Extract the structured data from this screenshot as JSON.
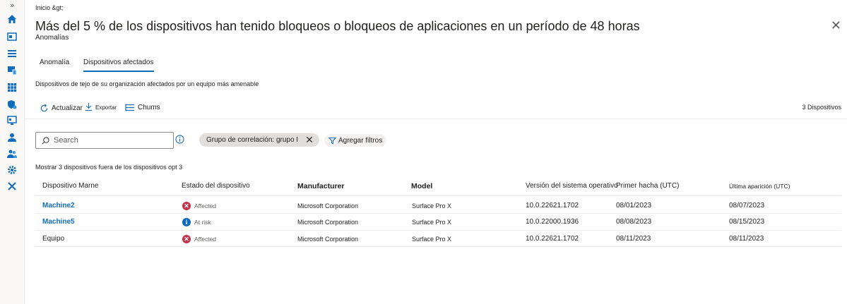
{
  "rail": {
    "expand_glyph": "»",
    "icons": [
      "home-icon",
      "dashboard-icon",
      "list-icon",
      "devices-icon",
      "apps-icon",
      "security-icon",
      "monitor-icon",
      "user-icon",
      "group-icon",
      "settings-gear-icon",
      "tools-icon"
    ]
  },
  "breadcrumb": "Inicio &gt;",
  "title": "Más del 5 % de los dispositivos han tenido bloqueos o bloqueos de aplicaciones en un período de 48 horas",
  "subtitle": "Anomalías",
  "close_glyph": "✕",
  "tabs": [
    {
      "label": "Anomalía"
    },
    {
      "label": "Dispositivos afectados"
    }
  ],
  "description": "Dispositivos de tejo de su organización afectados por un equipo más amenable",
  "commands": {
    "refresh": "Actualizar",
    "export": "Exportar",
    "columns": "Chums"
  },
  "device_count": "3  Dispositivos",
  "search": {
    "placeholder": "Search"
  },
  "filter_pill": {
    "label": "Grupo de correlación: grupo I",
    "remove_glyph": "✕"
  },
  "add_filters": "Agregar filtros",
  "showing_text": "Mostrar 3 dispositivos fuera de los dispositivos opt 3",
  "table": {
    "headers": [
      "Dispositivo Marne",
      "Estado del dispositivo",
      "Manufacturer",
      "Model",
      "Versión del sistema operativo",
      "Primer hacha (UTC)",
      "Última aparición (UTC)"
    ],
    "rows": [
      {
        "device": "Machine2",
        "status": "Affected",
        "status_icon": "x",
        "manufacturer": "Microsoft Corporation",
        "model": "Surface Pro X",
        "os": "10.0.22621.1702",
        "first": "08/01/2023",
        "last": "08/07/2023"
      },
      {
        "device": "Machine5",
        "status": "At risk",
        "status_icon": "i",
        "manufacturer": "Microsoft Corporation",
        "model": "Surface Pro X",
        "os": "10.0.22000.1936",
        "first": "08/08/2023",
        "last": "08/15/2023"
      },
      {
        "device": "Equipo",
        "status": "Affected",
        "status_icon": "x",
        "manufacturer": "Microsoft Corporation",
        "model": "Surface Pro X",
        "os": "10.0.22621.1702",
        "first": "08/11/2023",
        "last": "08/11/2023"
      }
    ]
  },
  "colors": {
    "accent": "#0f6cbd",
    "affected": "#c4314b",
    "at_risk": "#0f6cbd"
  }
}
